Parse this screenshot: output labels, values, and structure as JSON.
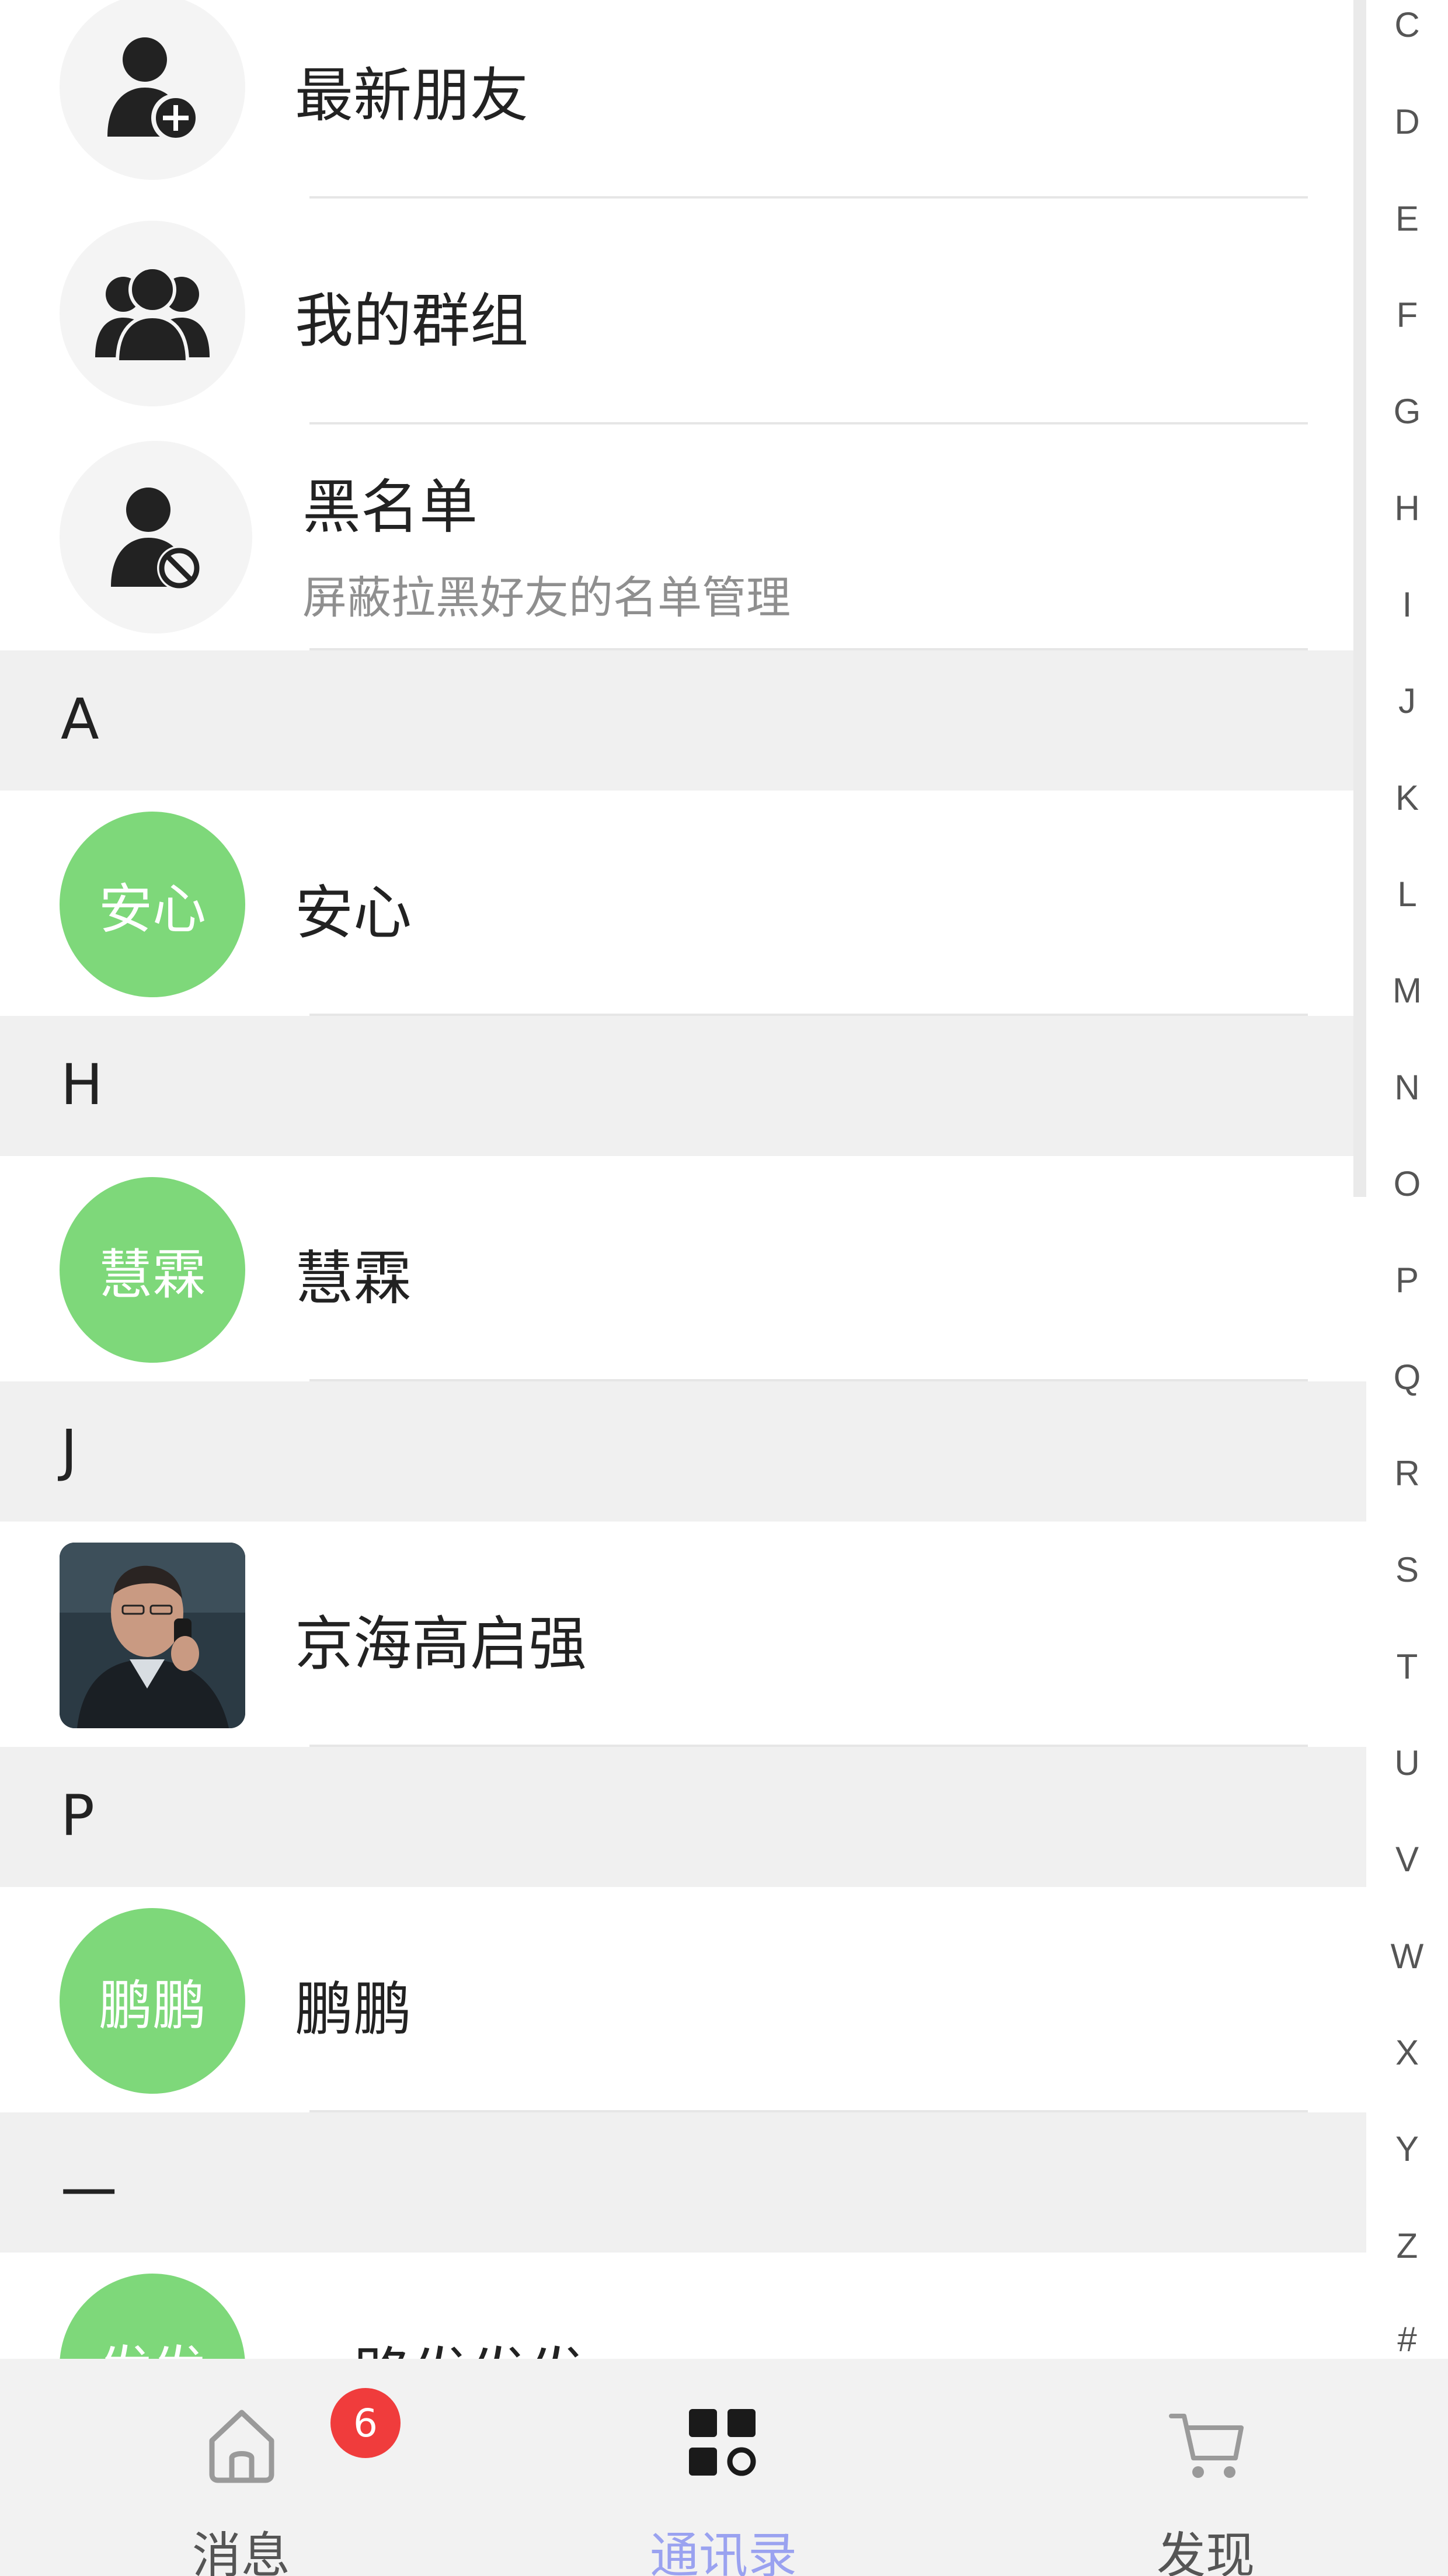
{
  "special_rows": [
    {
      "title": "最新朋友",
      "icon": "add-friend-icon"
    },
    {
      "title": "我的群组",
      "icon": "group-icon"
    },
    {
      "title": "黑名单",
      "subtitle": "屏蔽拉黑好友的名单管理",
      "icon": "blocked-user-icon"
    }
  ],
  "sections": [
    {
      "letter": "A",
      "contacts": [
        {
          "name": "安心",
          "avatar_text": "安心"
        }
      ]
    },
    {
      "letter": "H",
      "contacts": [
        {
          "name": "慧霖",
          "avatar_text": "慧霖"
        }
      ]
    },
    {
      "letter": "J",
      "contacts": [
        {
          "name": "京海高启强",
          "avatar_text": ""
        }
      ]
    },
    {
      "letter": "P",
      "contacts": [
        {
          "name": "鹏鹏",
          "avatar_text": "鹏鹏"
        }
      ]
    },
    {
      "letter": "一",
      "contacts": [
        {
          "name": "一路发发发",
          "avatar_text": "发发"
        }
      ]
    }
  ],
  "index_letters": [
    "C",
    "D",
    "E",
    "F",
    "G",
    "H",
    "I",
    "J",
    "K",
    "L",
    "M",
    "N",
    "O",
    "P",
    "Q",
    "R",
    "S",
    "T",
    "U",
    "V",
    "W",
    "X",
    "Y",
    "Z",
    "#"
  ],
  "tabs": [
    {
      "label": "消息",
      "icon": "home-icon",
      "badge": "6"
    },
    {
      "label": "通讯录",
      "icon": "contacts-grid-icon",
      "active": true
    },
    {
      "label": "发现",
      "icon": "cart-icon"
    }
  ],
  "colors": {
    "avatar_green": "#7ed87a",
    "active_tab": "#9aa2f0",
    "badge": "#f03c3c",
    "section_bg": "#f0f0f0"
  }
}
